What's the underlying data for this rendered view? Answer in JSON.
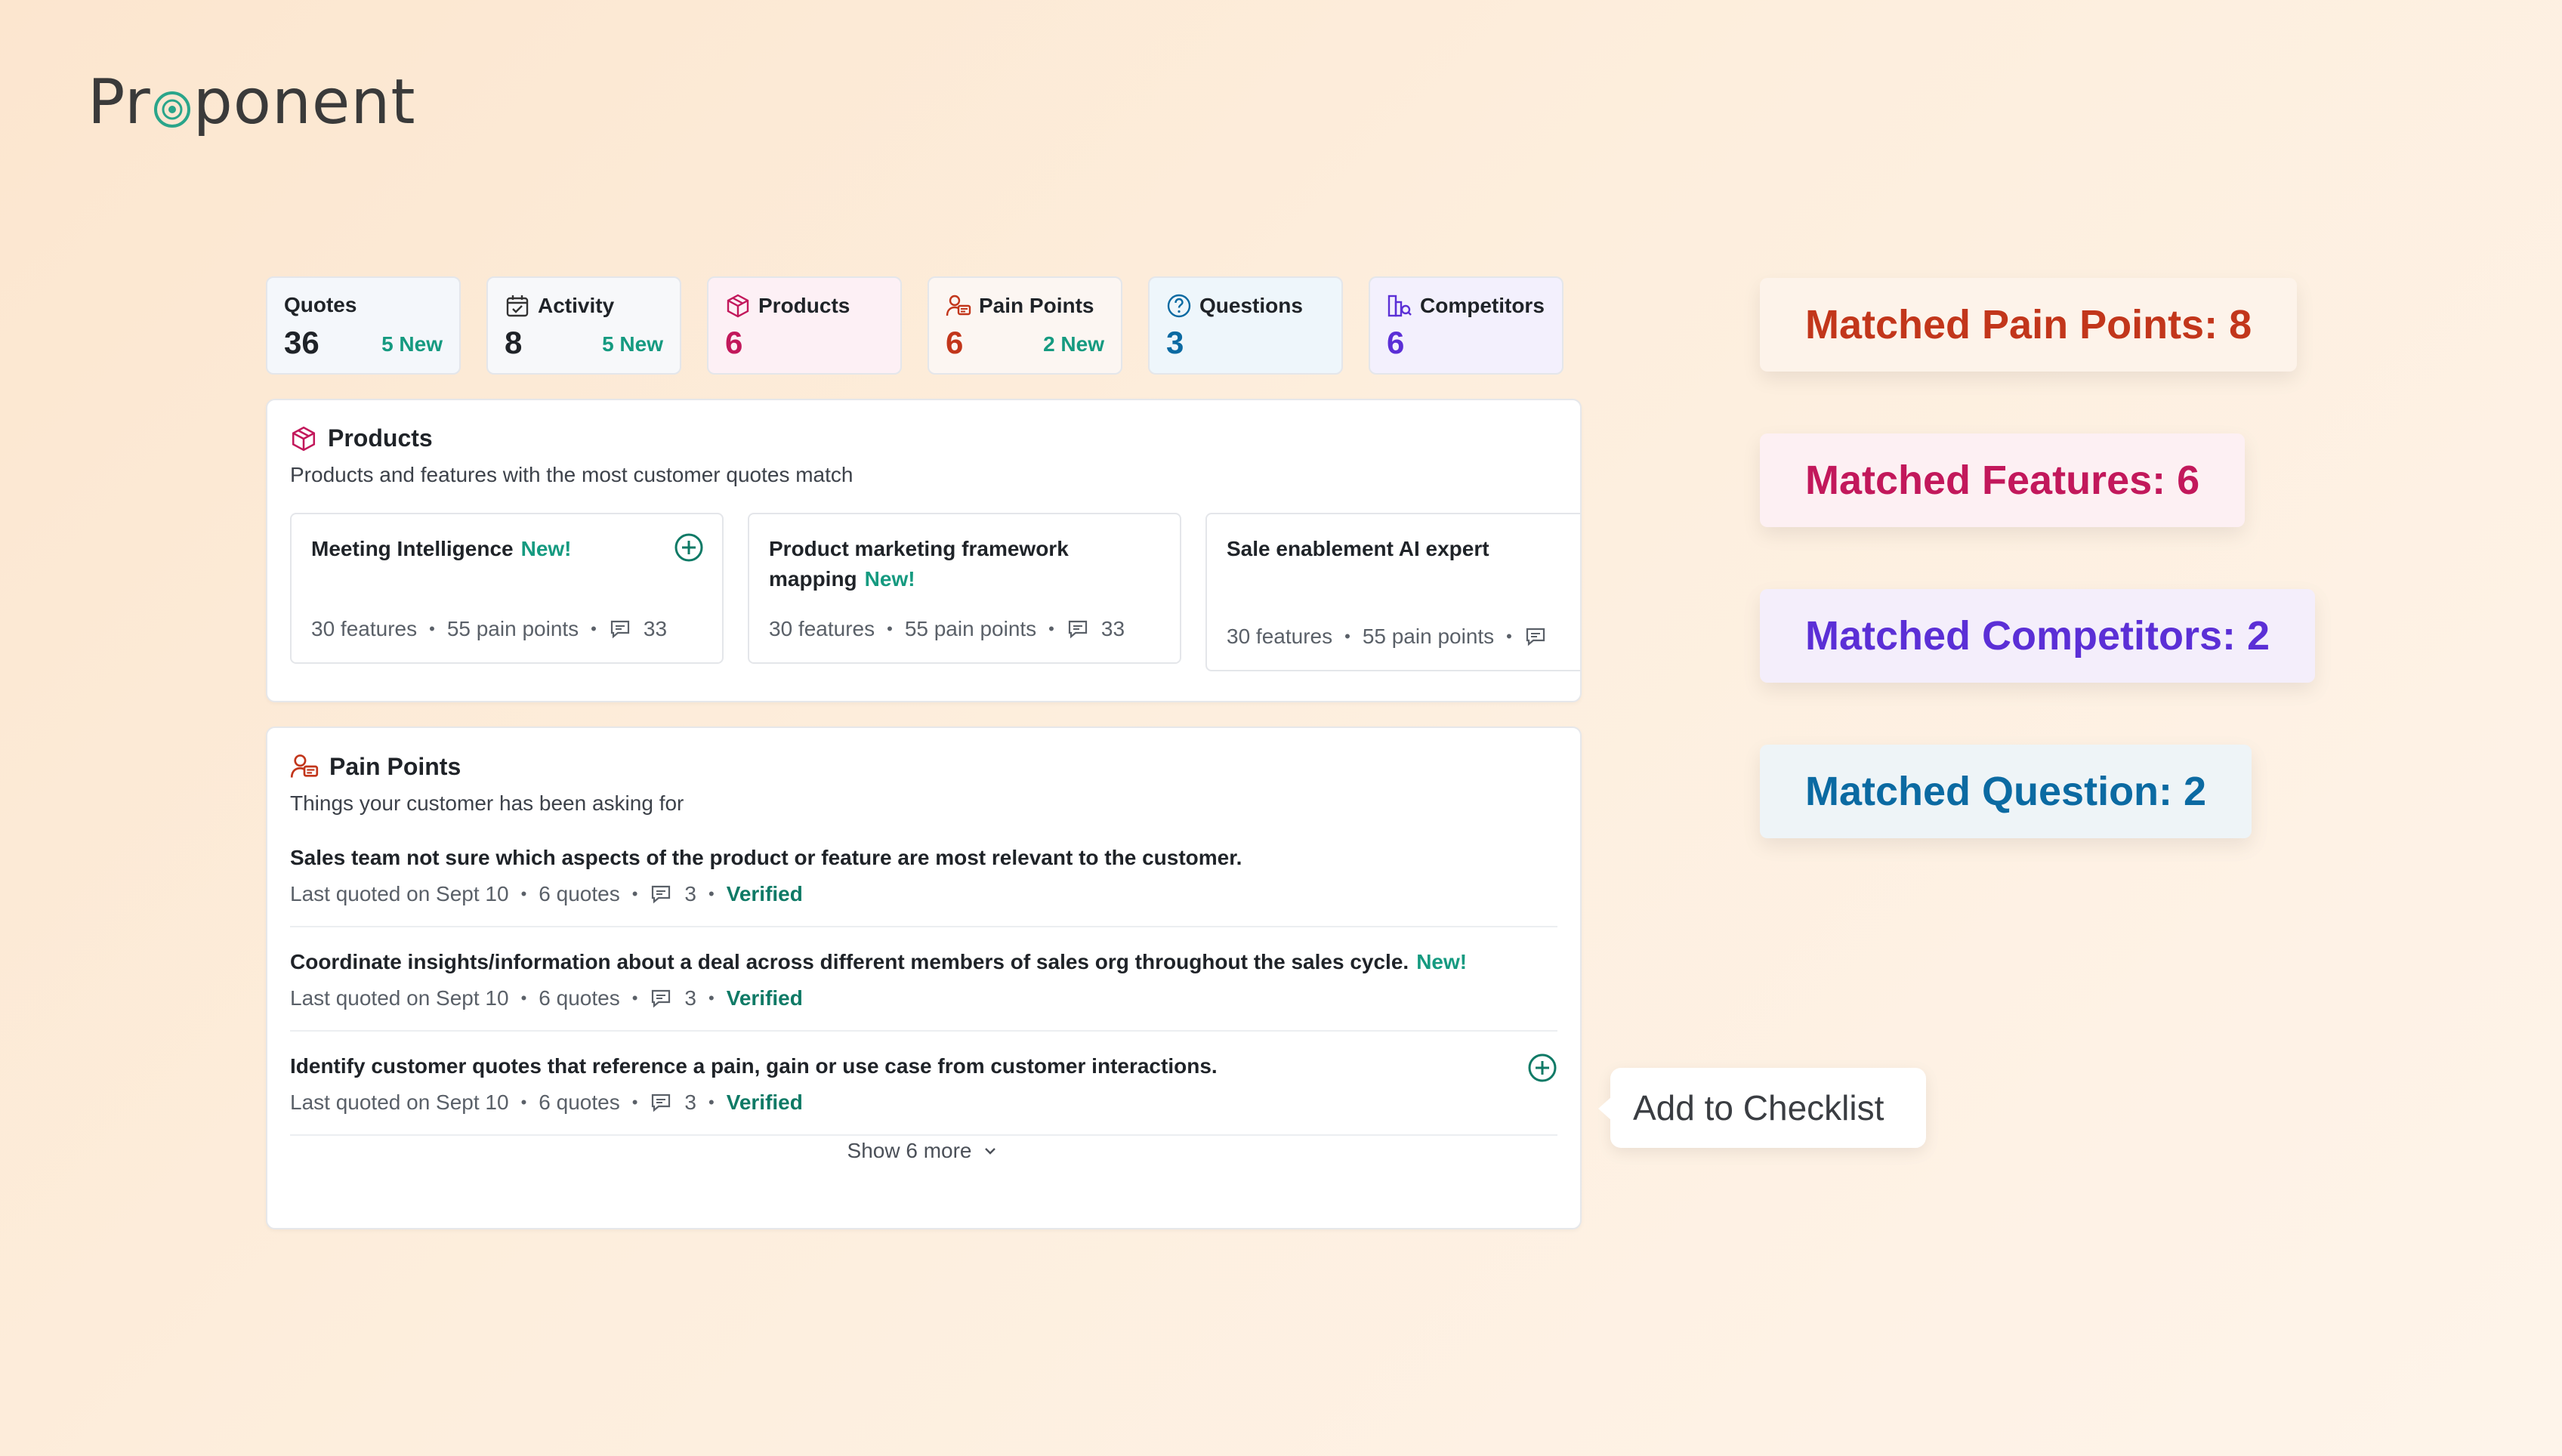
{
  "brand": {
    "name_left": "Pr",
    "name_right": "ponent"
  },
  "stats": [
    {
      "label": "Quotes",
      "value": "36",
      "new": "5 New",
      "color": "#1f2328",
      "bg": "#f4f7fb"
    },
    {
      "label": "Activity",
      "value": "8",
      "new": "5 New",
      "color": "#1f2328",
      "bg": "#f7f8fa"
    },
    {
      "label": "Products",
      "value": "6",
      "new": "",
      "color": "#c2185b",
      "bg": "#fdf0f5"
    },
    {
      "label": "Pain Points",
      "value": "6",
      "new": "2 New",
      "color": "#c2361b",
      "bg": "#fcf6f2"
    },
    {
      "label": "Questions",
      "value": "3",
      "new": "",
      "color": "#0b6aa2",
      "bg": "#eef6fb"
    },
    {
      "label": "Competitors",
      "value": "6",
      "new": "",
      "color": "#5b2fd6",
      "bg": "#f3f0fd"
    }
  ],
  "products": {
    "title": "Products",
    "subtitle": "Products and features with the most customer quotes match",
    "items": [
      {
        "name": "Meeting Intelligence",
        "new": "New!",
        "features": "30 features",
        "pain_points": "55 pain points",
        "comments": "33"
      },
      {
        "name": "Product marketing framework mapping",
        "new": "New!",
        "features": "30 features",
        "pain_points": "55 pain points",
        "comments": "33"
      },
      {
        "name": "Sale enablement AI expert",
        "new": "",
        "features": "30 features",
        "pain_points": "55 pain points",
        "comments": ""
      }
    ]
  },
  "pain_points": {
    "title": "Pain Points",
    "subtitle": "Things your customer has been asking for",
    "items": [
      {
        "text": "Sales team not sure which aspects of the product or feature are most relevant to the customer.",
        "new": "",
        "last_quoted": "Last quoted on Sept 10",
        "quotes": "6 quotes",
        "comments": "3",
        "status": "Verified"
      },
      {
        "text": "Coordinate insights/information about a deal across different members of sales org throughout the sales cycle.",
        "new": "New!",
        "last_quoted": "Last quoted on Sept 10",
        "quotes": "6 quotes",
        "comments": "3",
        "status": "Verified"
      },
      {
        "text": "Identify customer quotes that reference a pain, gain or use case from customer interactions.",
        "new": "",
        "last_quoted": "Last quoted on Sept 10",
        "quotes": "6 quotes",
        "comments": "3",
        "status": "Verified"
      }
    ],
    "show_more": "Show 6 more"
  },
  "tooltip": "Add to Checklist",
  "matches": [
    {
      "label": "Matched Pain Points: 8",
      "color": "#c2361b",
      "bg": "#fdf3ea"
    },
    {
      "label": "Matched Features: 6",
      "color": "#c2185b",
      "bg": "#fdf0f3"
    },
    {
      "label": "Matched Competitors: 2",
      "color": "#5b2fd6",
      "bg": "#f4eefb"
    },
    {
      "label": "Matched Question: 2",
      "color": "#0b6aa2",
      "bg": "#eef4f7"
    }
  ]
}
